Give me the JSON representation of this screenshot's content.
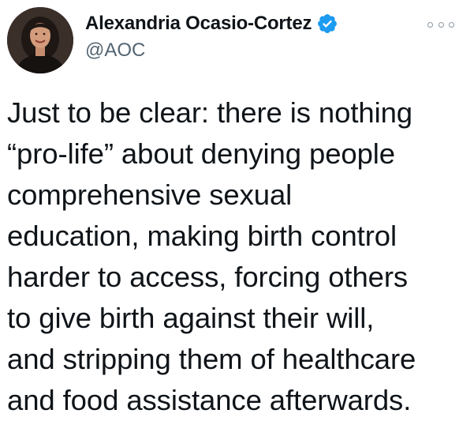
{
  "author": {
    "display_name": "Alexandria Ocasio-Cortez",
    "handle": "@AOC",
    "verified": true,
    "avatar": "profile-photo"
  },
  "tweet": {
    "lines": [
      "Just to be clear: there is nothing",
      "“pro-life” about denying people",
      "comprehensive sexual",
      "education, making birth control",
      "harder to access, forcing others",
      "to give birth against their will,",
      "and stripping them of healthcare",
      "and food assistance afterwards."
    ]
  },
  "icons": {
    "verified": "verified-badge-icon",
    "more": "more-options-icon"
  },
  "colors": {
    "verified_blue": "#1d9bf0",
    "handle_gray": "#536471",
    "text": "#0f1419"
  }
}
